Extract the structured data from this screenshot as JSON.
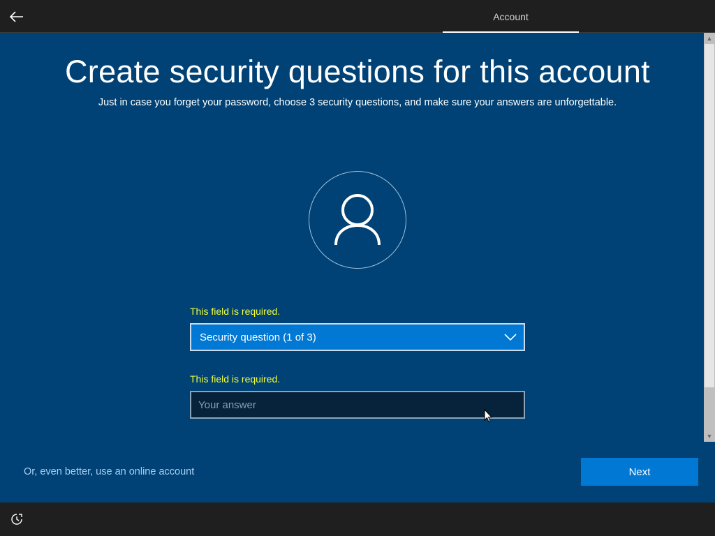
{
  "header": {
    "tab_label": "Account"
  },
  "main": {
    "title": "Create security questions for this account",
    "subtitle": "Just in case you forget your password, choose 3 security questions, and make sure your answers are unforgettable.",
    "question_error": "This field is required.",
    "question_selected": "Security question (1 of 3)",
    "answer_error": "This field is required.",
    "answer_placeholder": "Your answer"
  },
  "footer": {
    "online_account_link": "Or, even better, use an online account",
    "next_label": "Next"
  },
  "icons": {
    "back": "back-arrow-icon",
    "avatar": "user-icon",
    "dropdown": "chevron-down-icon",
    "ease_of_access": "ease-of-access-icon"
  },
  "colors": {
    "background": "#004275",
    "accent": "#0078d4",
    "error": "#f2ff3b",
    "link": "#a8d0f5",
    "bar": "#1f1f1f"
  }
}
